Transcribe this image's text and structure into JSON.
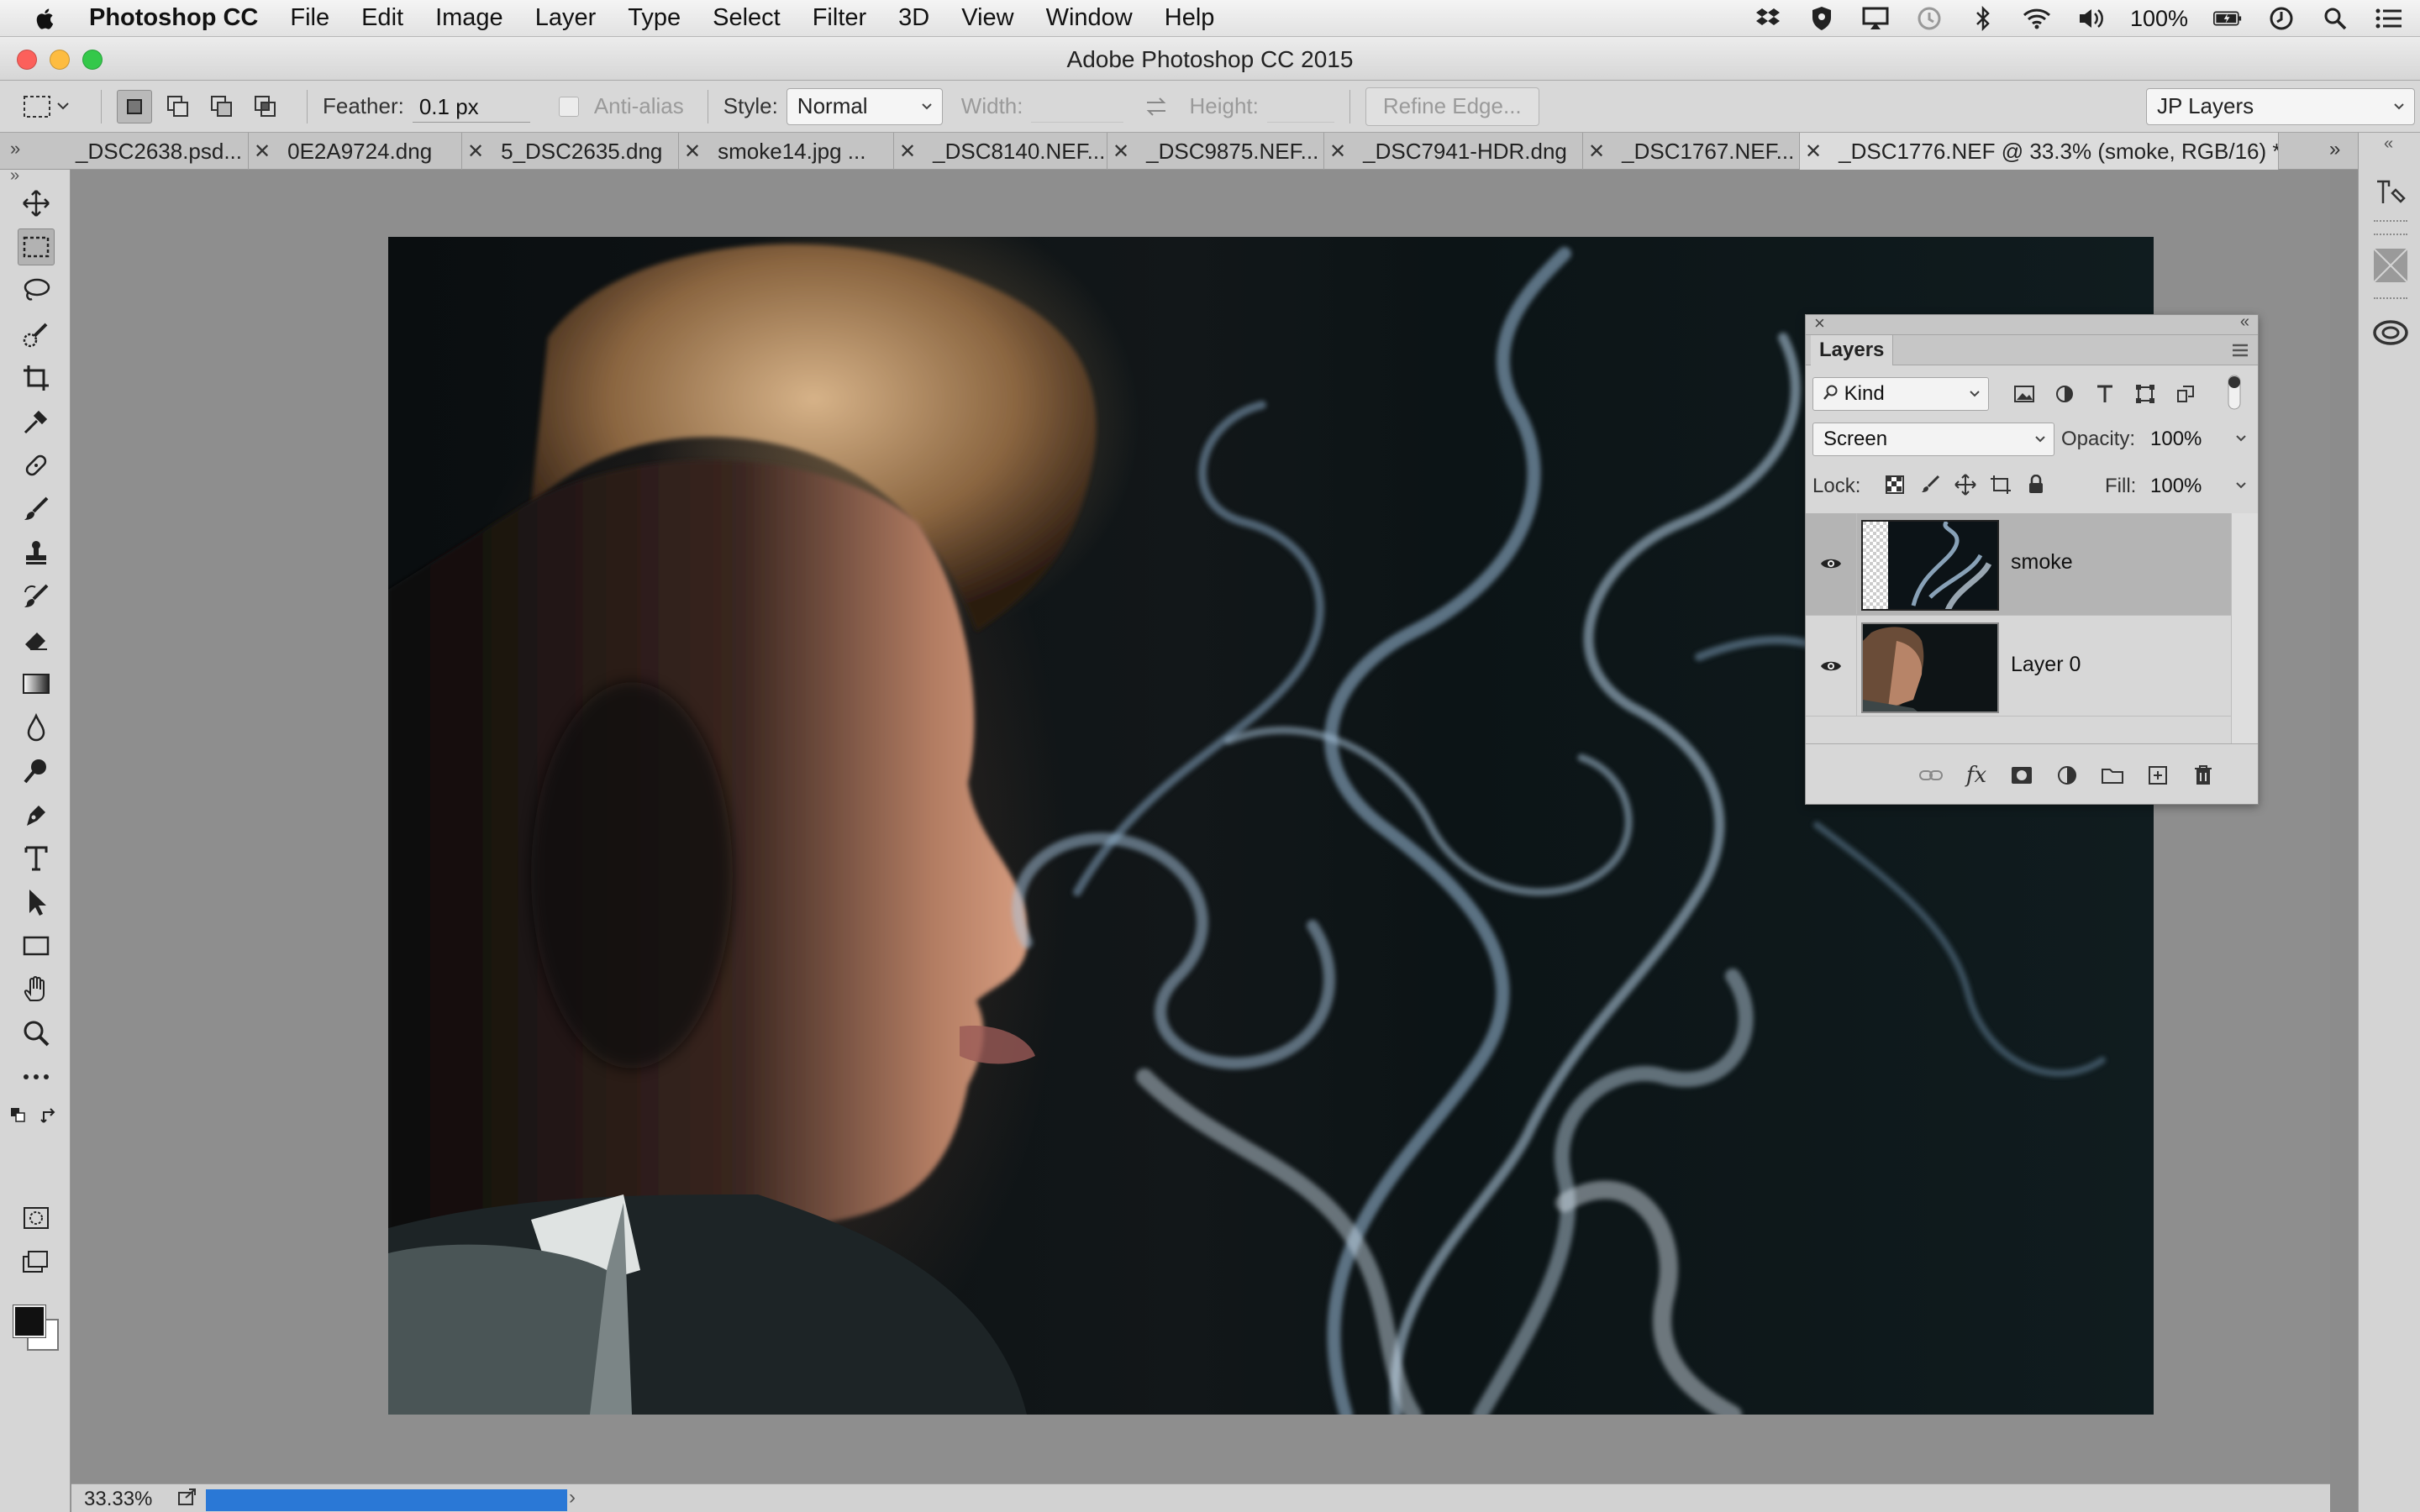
{
  "menubar": {
    "items": [
      "Photoshop CC",
      "File",
      "Edit",
      "Image",
      "Layer",
      "Type",
      "Select",
      "Filter",
      "3D",
      "View",
      "Window",
      "Help"
    ],
    "battery": "100%",
    "status_icons": [
      "dropbox-icon",
      "vpn-shield-icon",
      "airplay-icon",
      "time-machine-icon",
      "bluetooth-icon",
      "wifi-icon",
      "volume-icon",
      "battery-icon",
      "clock-icon",
      "spotlight-search-icon",
      "notification-list-icon"
    ]
  },
  "window": {
    "title": "Adobe Photoshop CC 2015"
  },
  "options": {
    "feather_label": "Feather:",
    "feather_value": "0.1 px",
    "antialias_label": "Anti-alias",
    "style_label": "Style:",
    "style_value": "Normal",
    "width_label": "Width:",
    "height_label": "Height:",
    "refine_edge_label": "Refine Edge...",
    "workspace": "JP Layers"
  },
  "tabs": [
    {
      "label": "_DSC2638.psd...",
      "active": false
    },
    {
      "label": "0E2A9724.dng",
      "active": false
    },
    {
      "label": "5_DSC2635.dng",
      "active": false
    },
    {
      "label": "smoke14.jpg ...",
      "active": false
    },
    {
      "label": "_DSC8140.NEF...",
      "active": false
    },
    {
      "label": "_DSC9875.NEF...",
      "active": false
    },
    {
      "label": "_DSC7941-HDR.dng",
      "active": false
    },
    {
      "label": "_DSC1767.NEF...",
      "active": false
    },
    {
      "label": "_DSC1776.NEF @ 33.3% (smoke, RGB/16) *",
      "active": true
    }
  ],
  "tools": [
    "move-tool",
    "rectangular-marquee-tool",
    "lasso-tool",
    "quick-selection-tool",
    "crop-tool",
    "eyedropper-tool",
    "healing-brush-tool",
    "brush-tool",
    "clone-stamp-tool",
    "history-brush-tool",
    "eraser-tool",
    "gradient-tool",
    "blur-tool",
    "dodge-tool",
    "pen-tool",
    "type-tool",
    "path-selection-tool",
    "rectangle-tool",
    "hand-tool",
    "zoom-tool",
    "edit-toolbar"
  ],
  "active_tool": "rectangular-marquee-tool",
  "colors": {
    "foreground": "#111111",
    "background": "#ffffff",
    "accent": "#2a78d6"
  },
  "layers_panel": {
    "title": "Layers",
    "filter_kind": "Kind",
    "blend_mode": "Screen",
    "opacity_label": "Opacity:",
    "opacity_value": "100%",
    "lock_label": "Lock:",
    "fill_label": "Fill:",
    "fill_value": "100%",
    "layers": [
      {
        "name": "smoke",
        "visible": true,
        "selected": true
      },
      {
        "name": "Layer 0",
        "visible": true,
        "selected": false
      }
    ]
  },
  "status": {
    "zoom": "33.33%",
    "progress": 1.0
  }
}
